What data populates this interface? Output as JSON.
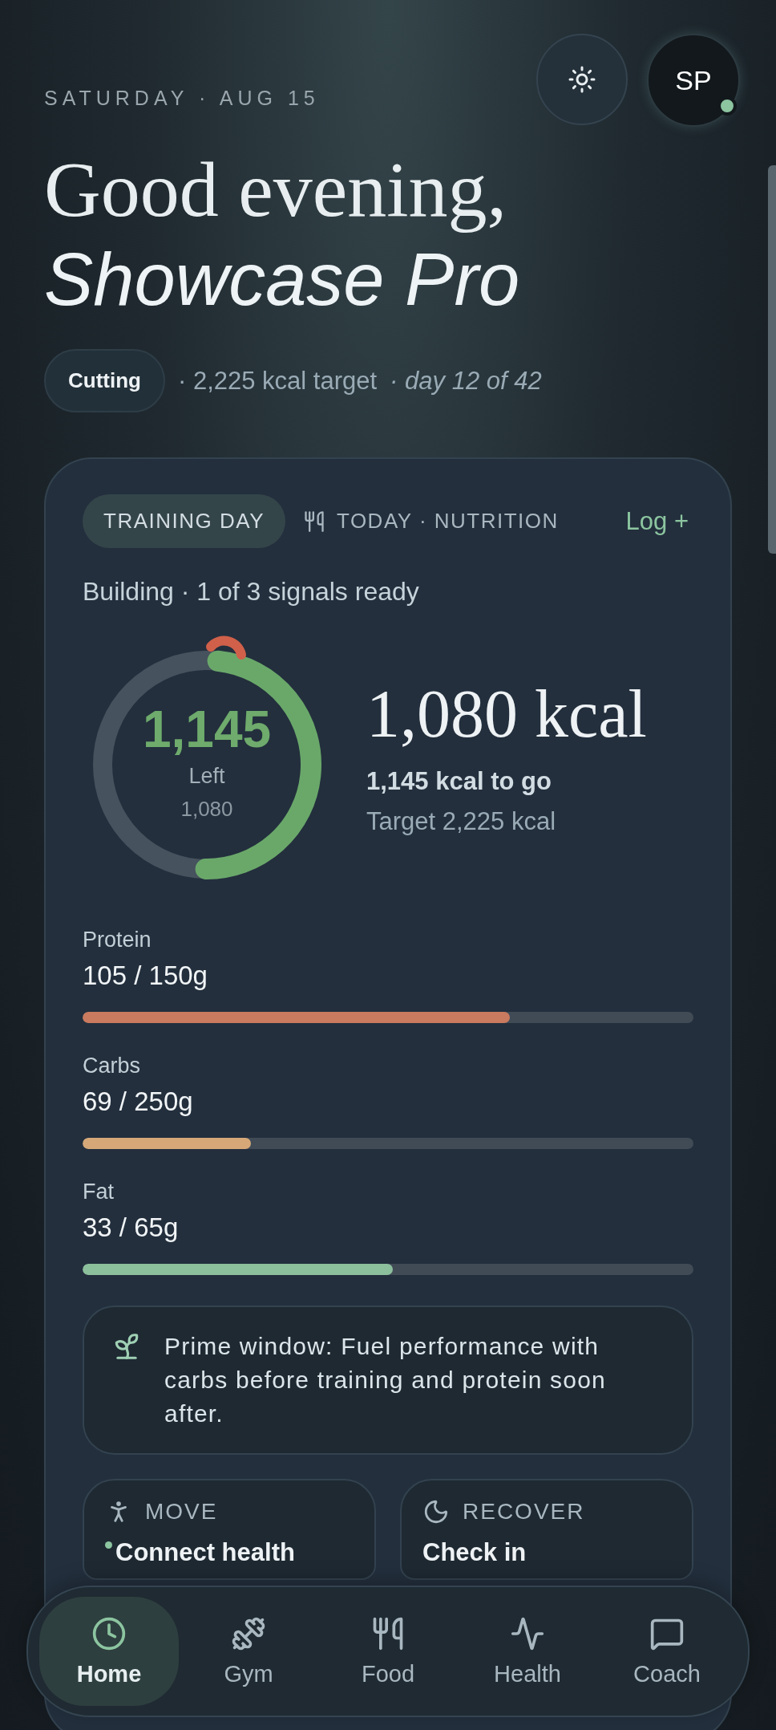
{
  "header": {
    "date": "SATURDAY · AUG 15",
    "greeting": "Good evening,",
    "name": "Showcase Pro",
    "avatar": {
      "initials": "SP",
      "online": true
    }
  },
  "phase": {
    "badge": "Cutting",
    "target": "· 2,225 kcal target",
    "progress": "· day 12 of 42"
  },
  "card": {
    "tabs": [
      {
        "label": "TRAINING DAY",
        "selected": true
      },
      {
        "label": "TODAY · NUTRITION",
        "selected": false
      }
    ],
    "log_button": "Log +",
    "status": "Building · 1 of 3 signals ready",
    "ring": {
      "level": 0.485,
      "value": "1,145",
      "label": "Left",
      "sub": "1,080"
    },
    "summary": {
      "consumed": "1,080 kcal",
      "remaining": "1,145 kcal to go",
      "target": "Target 2,225 kcal"
    },
    "macros": [
      {
        "name": "Protein",
        "value": "105 / 150g",
        "level": 0.7,
        "color": "#c97a5f"
      },
      {
        "name": "Carbs",
        "value": "69 / 250g",
        "level": 0.276,
        "color": "#d6a878"
      },
      {
        "name": "Fat",
        "value": "33 / 65g",
        "level": 0.508,
        "color": "#8cbf9c"
      }
    ],
    "tip": "Prime window: Fuel performance with carbs before training and protein soon after.",
    "tiles": [
      {
        "title": "MOVE",
        "text": "Connect health",
        "dot": true
      },
      {
        "title": "RECOVER",
        "text": "Check in",
        "dot": false
      }
    ]
  },
  "nav": [
    {
      "label": "Home",
      "selected": true
    },
    {
      "label": "Gym",
      "selected": false
    },
    {
      "label": "Food",
      "selected": false
    },
    {
      "label": "Health",
      "selected": false
    },
    {
      "label": "Coach",
      "selected": false
    }
  ]
}
